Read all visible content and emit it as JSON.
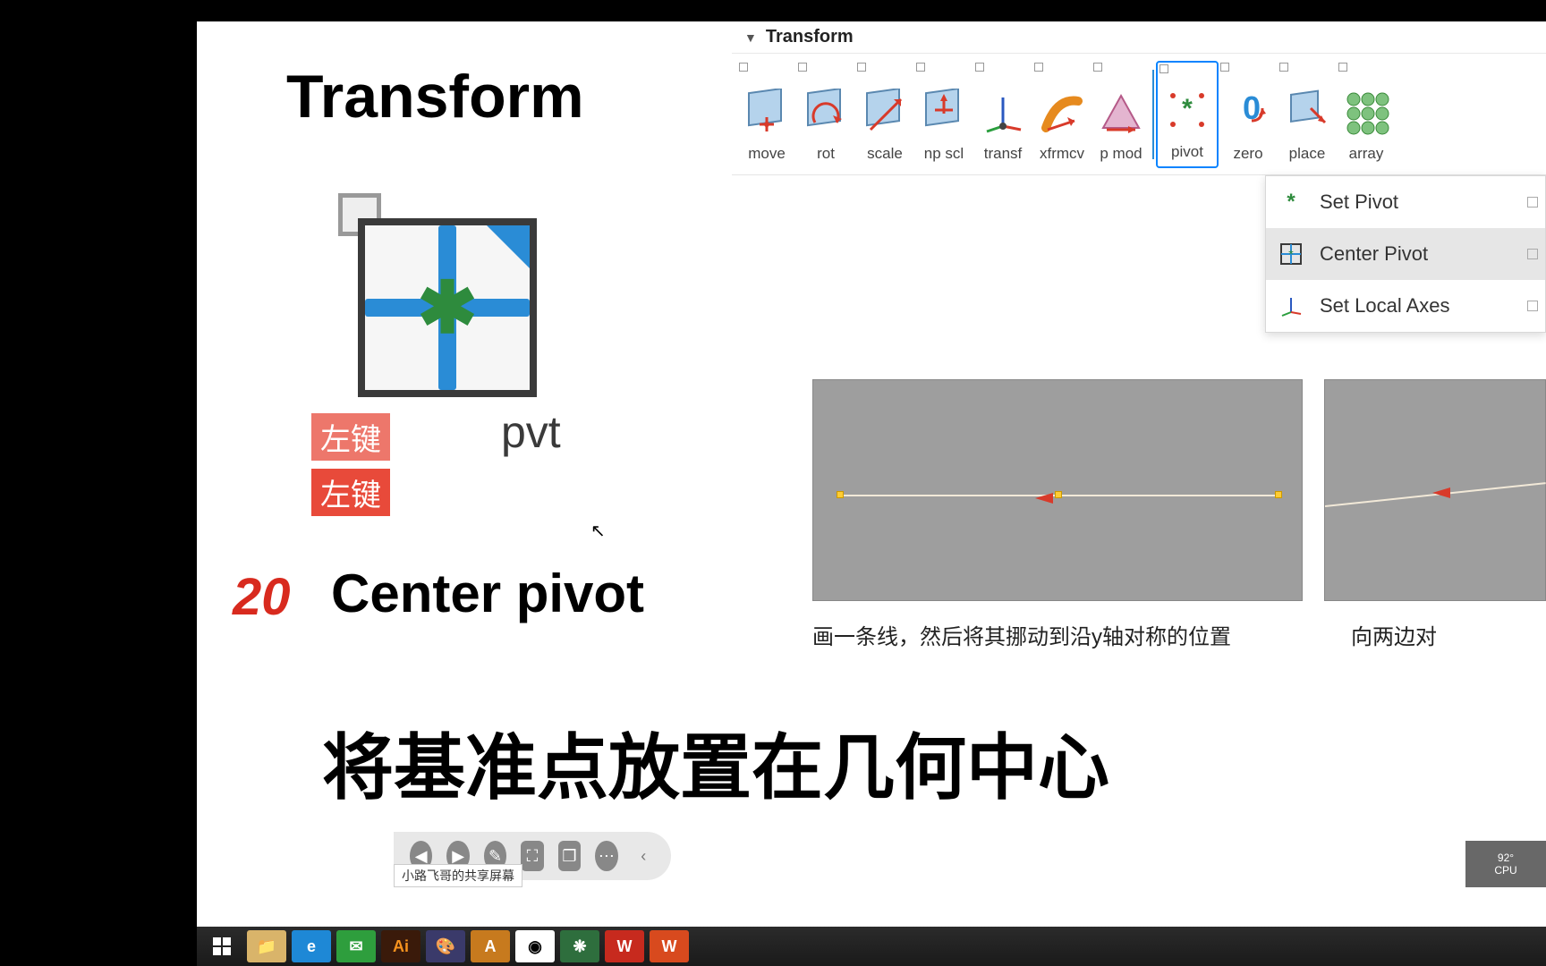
{
  "left_title": "Transform",
  "panel": {
    "header": "Transform"
  },
  "tools": [
    {
      "label": "move"
    },
    {
      "label": "rot"
    },
    {
      "label": "scale"
    },
    {
      "label": "np scl"
    },
    {
      "label": "transf"
    },
    {
      "label": "xfrmcv"
    },
    {
      "label": "p mod"
    },
    {
      "label": "pivot"
    },
    {
      "label": "zero"
    },
    {
      "label": "place"
    },
    {
      "label": "array"
    }
  ],
  "dropdown": [
    {
      "label": "Set Pivot"
    },
    {
      "label": "Center Pivot"
    },
    {
      "label": "Set Local Axes"
    }
  ],
  "badges": {
    "a": "左键",
    "b": "左键"
  },
  "pvt_text": "pvt",
  "number": "20",
  "heading": "Center pivot",
  "chinese_big": "将基准点放置在几何中心",
  "caption1": "画一条线，然后将其挪动到沿y轴对称的位置",
  "caption2": "向两边对",
  "share": "小路飞哥的共享屏幕",
  "topright": {
    "a": "92°",
    "b": "CPU"
  }
}
